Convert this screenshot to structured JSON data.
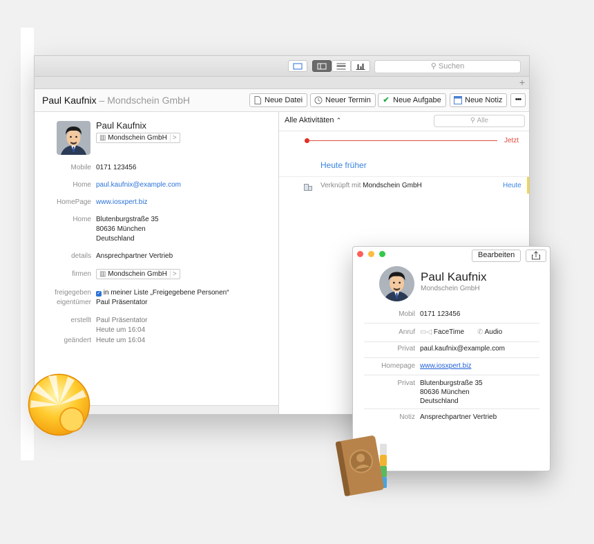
{
  "toolbar": {
    "search_placeholder": "Suchen"
  },
  "header": {
    "name": "Paul Kaufnix",
    "dash": "–",
    "company": "Mondschein GmbH",
    "buttons": [
      {
        "label": "Neue Datei",
        "icon": "document-icon"
      },
      {
        "label": "Neuer Termin",
        "icon": "clock-icon"
      },
      {
        "label": "Neue Aufgabe",
        "icon": "checkmark-icon"
      },
      {
        "label": "Neue Notiz",
        "icon": "note-icon"
      }
    ],
    "more": "•••"
  },
  "contact": {
    "name": "Paul Kaufnix",
    "company_chip": "Mondschein GmbH",
    "chip_arrow": ">",
    "fields": {
      "mobile_label": "Mobile",
      "mobile": "0171 123456",
      "home_label": "Home",
      "email": "paul.kaufnix@example.com",
      "homepage_label": "HomePage",
      "homepage": "www.iosxpert.biz",
      "address_label": "Home",
      "address1": "Blutenburgstraße 35",
      "address2": "80636 München",
      "address3": "Deutschland",
      "details_label": "details",
      "details": "Ansprechpartner Vertrieb",
      "firmen_label": "firmen",
      "firmen": "Mondschein GmbH",
      "freigegeben_label": "freigegeben",
      "freigegeben": "in meiner Liste „Freigegebene Personen“",
      "eigentuemer_label": "eigentümer",
      "eigentuemer": "Paul Präsentator",
      "erstellt_label": "erstellt",
      "erstellt": "Paul Präsentator",
      "erstellt_time": "Heute um 16:04",
      "geaendert_label": "geändert",
      "geaendert": "Heute um 16:04"
    }
  },
  "activities": {
    "filter": "Alle Aktivitäten",
    "filter_arrow": "⌃",
    "search_placeholder": "Alle",
    "now_label": "Jetzt",
    "section": "Heute früher",
    "row_prefix": "Verknüpft mit",
    "row_company": "Mondschein GmbH",
    "row_when": "Heute"
  },
  "card": {
    "edit": "Bearbeiten",
    "name": "Paul Kaufnix",
    "company": "Mondschein GmbH",
    "mobil_label": "Mobil",
    "mobil": "0171 123456",
    "anruf_label": "Anruf",
    "facetime": "FaceTime",
    "audio": "Audio",
    "privat_label": "Privat",
    "email": "paul.kaufnix@example.com",
    "homepage_label": "Homepage",
    "homepage": "www.iosxpert.biz",
    "address_label": "Privat",
    "address1": "Blutenburgstraße 35",
    "address2": "80636 München",
    "address3": "Deutschland",
    "notiz_label": "Notiz",
    "notiz": "Ansprechpartner Vertrieb"
  },
  "colors": {
    "accent": "#2a72d8",
    "now_line": "#e04a3c",
    "highlight": "#f2d64c"
  }
}
